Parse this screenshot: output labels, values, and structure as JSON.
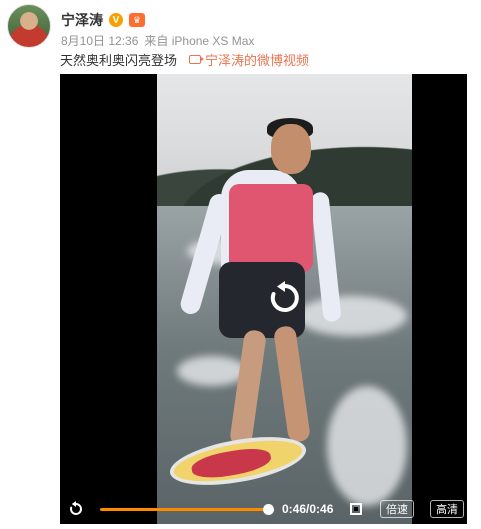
{
  "post": {
    "author": "宁泽涛",
    "date": "8月10日 12:36",
    "source": "来自 iPhone XS Max",
    "text": "天然奥利奥闪亮登场",
    "video_link": "宁泽涛的微博视频"
  },
  "badges": {
    "verified": "V",
    "level": "♛"
  },
  "player": {
    "time": "0:46/0:46",
    "progress": 1.0,
    "speed_label": "倍速",
    "quality_label": "高清"
  },
  "colors": {
    "accent": "#ff8a00",
    "link": "#eb7350"
  },
  "icons": [
    "avatar",
    "verified-badge-icon",
    "level-badge-icon",
    "video-camera-icon",
    "replay-icon",
    "fullscreen-icon"
  ]
}
